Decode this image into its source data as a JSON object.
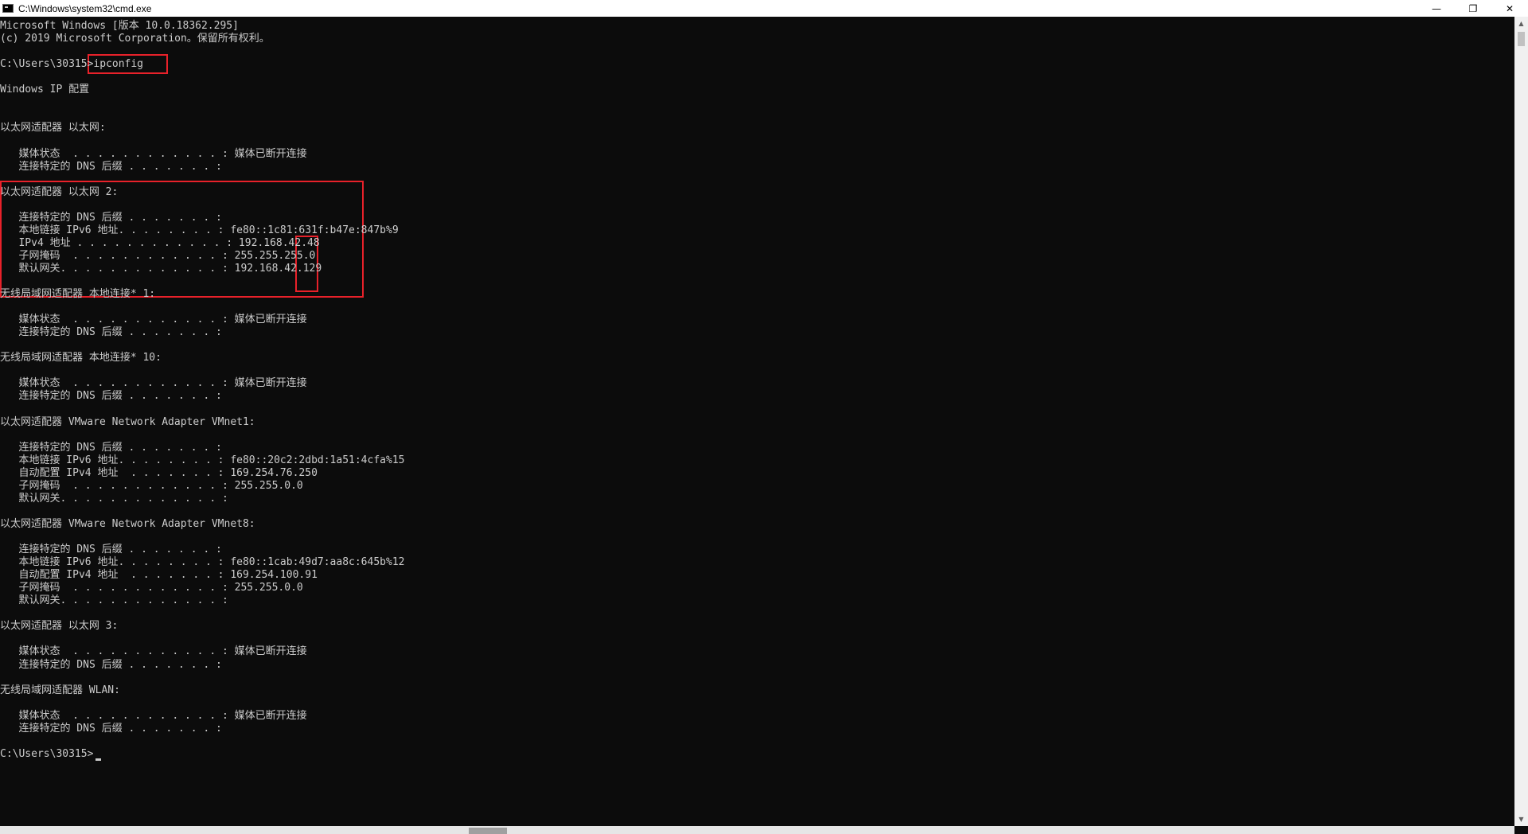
{
  "window": {
    "title": "C:\\Windows\\system32\\cmd.exe",
    "controls": {
      "minimize": "—",
      "maximize": "❐",
      "close": "✕"
    }
  },
  "console": {
    "lines": [
      "Microsoft Windows [版本 10.0.18362.295]",
      "(c) 2019 Microsoft Corporation。保留所有权利。",
      "",
      "C:\\Users\\30315>ipconfig",
      "",
      "Windows IP 配置",
      "",
      "",
      "以太网适配器 以太网:",
      "",
      "   媒体状态  . . . . . . . . . . . . : 媒体已断开连接",
      "   连接特定的 DNS 后缀 . . . . . . . :",
      "",
      "以太网适配器 以太网 2:",
      "",
      "   连接特定的 DNS 后缀 . . . . . . . :",
      "   本地链接 IPv6 地址. . . . . . . . : fe80::1c81:631f:b47e:847b%9",
      "   IPv4 地址 . . . . . . . . . . . . : 192.168.42.48",
      "   子网掩码  . . . . . . . . . . . . : 255.255.255.0",
      "   默认网关. . . . . . . . . . . . . : 192.168.42.129",
      "",
      "无线局域网适配器 本地连接* 1:",
      "",
      "   媒体状态  . . . . . . . . . . . . : 媒体已断开连接",
      "   连接特定的 DNS 后缀 . . . . . . . :",
      "",
      "无线局域网适配器 本地连接* 10:",
      "",
      "   媒体状态  . . . . . . . . . . . . : 媒体已断开连接",
      "   连接特定的 DNS 后缀 . . . . . . . :",
      "",
      "以太网适配器 VMware Network Adapter VMnet1:",
      "",
      "   连接特定的 DNS 后缀 . . . . . . . :",
      "   本地链接 IPv6 地址. . . . . . . . : fe80::20c2:2dbd:1a51:4cfa%15",
      "   自动配置 IPv4 地址  . . . . . . . : 169.254.76.250",
      "   子网掩码  . . . . . . . . . . . . : 255.255.0.0",
      "   默认网关. . . . . . . . . . . . . :",
      "",
      "以太网适配器 VMware Network Adapter VMnet8:",
      "",
      "   连接特定的 DNS 后缀 . . . . . . . :",
      "   本地链接 IPv6 地址. . . . . . . . : fe80::1cab:49d7:aa8c:645b%12",
      "   自动配置 IPv4 地址  . . . . . . . : 169.254.100.91",
      "   子网掩码  . . . . . . . . . . . . : 255.255.0.0",
      "   默认网关. . . . . . . . . . . . . :",
      "",
      "以太网适配器 以太网 3:",
      "",
      "   媒体状态  . . . . . . . . . . . . : 媒体已断开连接",
      "   连接特定的 DNS 后缀 . . . . . . . :",
      "",
      "无线局域网适配器 WLAN:",
      "",
      "   媒体状态  . . . . . . . . . . . . : 媒体已断开连接",
      "   连接特定的 DNS 后缀 . . . . . . . :",
      "",
      "C:\\Users\\30315>"
    ]
  },
  "colors": {
    "background": "#0c0c0c",
    "text": "#cccccc",
    "highlight": "#e8212a"
  },
  "icons": {
    "app": "cmd-icon",
    "minimize": "minimize-icon",
    "maximize": "restore-icon",
    "close": "close-icon"
  }
}
